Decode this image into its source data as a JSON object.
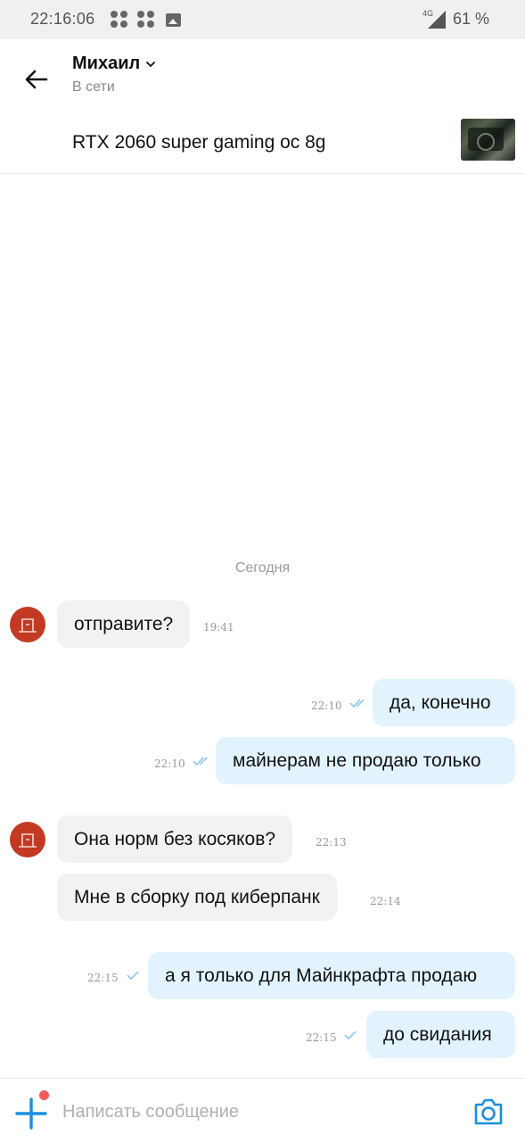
{
  "status_bar": {
    "time": "22:16:06",
    "network": "4G",
    "battery": "61 %",
    "icons": [
      "notification-dots-icon",
      "notification-dots-icon",
      "image-icon",
      "signal-icon"
    ]
  },
  "header": {
    "contact_name": "Михаил",
    "status": "В сети",
    "listing_title": "RTX 2060 super gaming oc 8g",
    "icons": [
      "back-arrow-icon",
      "chevron-down-icon",
      "listing-thumbnail"
    ]
  },
  "chat": {
    "date_separator": "Сегодня",
    "messages": [
      {
        "direction": "in",
        "text": "отправите?",
        "time": "19:41"
      },
      {
        "direction": "out",
        "text": "да, конечно",
        "time": "22:10",
        "status": "read"
      },
      {
        "direction": "out",
        "text": "майнерам не продаю только",
        "time": "22:10",
        "status": "read"
      },
      {
        "direction": "in",
        "text": "Она норм без косяков?",
        "time": "22:13"
      },
      {
        "direction": "in",
        "text": "Мне в сборку под киберпанк",
        "time": "22:14"
      },
      {
        "direction": "out",
        "text": "а я только для Майнкрафта продаю",
        "time": "22:15",
        "status": "sent"
      },
      {
        "direction": "out",
        "text": "до свидания",
        "time": "22:15",
        "status": "sent"
      }
    ]
  },
  "composer": {
    "placeholder": "Написать сообщение",
    "value": "",
    "icons": [
      "plus-icon",
      "camera-icon"
    ]
  },
  "colors": {
    "accent": "#1a8fe0",
    "incoming_bubble": "#f2f2f2",
    "outgoing_bubble": "#e3f3fd",
    "avatar": "#c23a24",
    "badge_dot": "#f25a5a"
  }
}
